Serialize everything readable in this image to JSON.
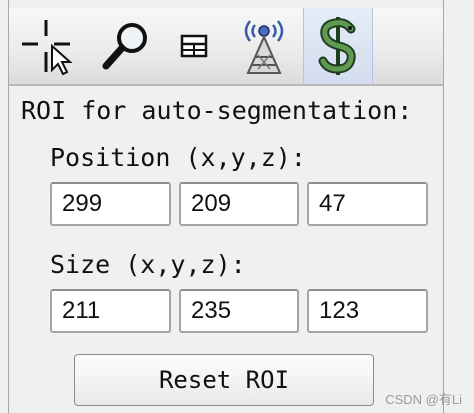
{
  "toolbar": {
    "tools": [
      {
        "icon": "crosshair-cursor-icon"
      },
      {
        "icon": "magnifier-icon"
      },
      {
        "icon": "grid-icon"
      },
      {
        "icon": "radiation-tower-icon"
      },
      {
        "icon": "dollar-snake-icon",
        "active": true
      }
    ]
  },
  "roi": {
    "section_label": "ROI for auto-segmentation:",
    "position_label": "Position (x,y,z):",
    "position": {
      "x": "299",
      "y": "209",
      "z": "47"
    },
    "size_label": "Size (x,y,z):",
    "size": {
      "x": "211",
      "y": "235",
      "z": "123"
    },
    "reset_label": "Reset ROI"
  },
  "watermark": "CSDN @有Li",
  "colors": {
    "active_tool_bg": "#d8e1f1",
    "panel_bg": "#f0f0f0"
  }
}
